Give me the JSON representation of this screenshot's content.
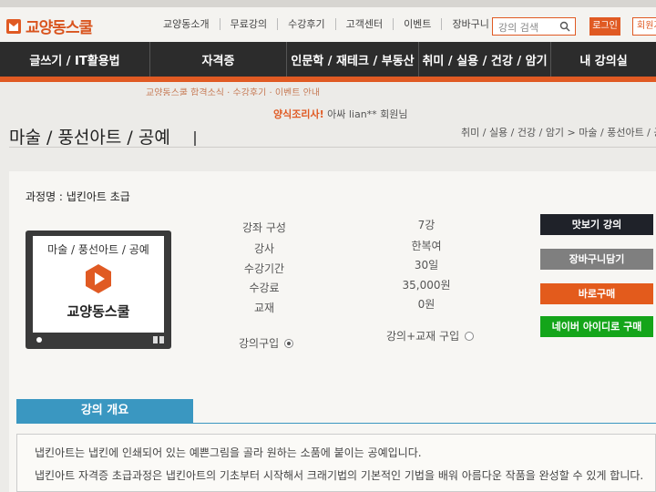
{
  "header": {
    "logo_text": "교양동스쿨",
    "topnav": [
      "교양동소개",
      "무료강의",
      "수강후기",
      "고객센터",
      "이벤트",
      "장바구니"
    ],
    "search_placeholder": "강의 검색",
    "login_label": "로그인",
    "join_label": "회원가"
  },
  "mainnav": [
    "글쓰기 / IT활용법",
    "자격증",
    "인문학 / 재테크 / 부동산",
    "취미 / 실용 / 건강 / 암기",
    "내 강의실"
  ],
  "banners": {
    "line1": "교양동스쿨 합격소식 · 수강후기 · 이벤트 안내",
    "line2_highlight": "양식조리사!",
    "line2_rest": " 아싸  lian** 회원님"
  },
  "page": {
    "title": "마술 / 풍선아트 / 공예",
    "breadcrumb": "취미 / 실용 / 건강 / 암기 > 마술 / 풍선아트 / 공"
  },
  "course": {
    "name_label": "과정명 : 냅킨아트 초급",
    "thumb_category": "마술 / 풍선아트 / 공예",
    "thumb_brand": "교양동스쿨",
    "info": [
      {
        "label": "강좌 구성",
        "value": "7강"
      },
      {
        "label": "강사",
        "value": "한복여"
      },
      {
        "label": "수강기간",
        "value": "30일"
      },
      {
        "label": "수강료",
        "value": "35,000원"
      },
      {
        "label": "교재",
        "value": "0원"
      }
    ],
    "options": [
      {
        "label": "강의구입",
        "selected": true
      },
      {
        "label": "강의+교재 구입",
        "selected": false
      }
    ]
  },
  "buttons": {
    "preview": "맛보기 강의",
    "cart": "장바구니담기",
    "buy": "바로구매",
    "naver": "네이버 아이디로 구매"
  },
  "overview": {
    "tab": "강의 개요",
    "line1": "냅킨아트는 냅킨에 인쇄되어 있는 예쁜그림을 골라 원하는 소품에 붙이는 공예입니다.",
    "line2": "냅킨아트 자격증 초급과정은 냅킨아트의 기초부터 시작해서 크래기법의 기본적인 기법을 배워 아름다운 작품을 완성할 수 있게 합니다."
  },
  "colors": {
    "accent": "#e05a23",
    "nav_bg": "#2c2c2c",
    "section": "#3a97c1",
    "naver": "#14a51a"
  }
}
